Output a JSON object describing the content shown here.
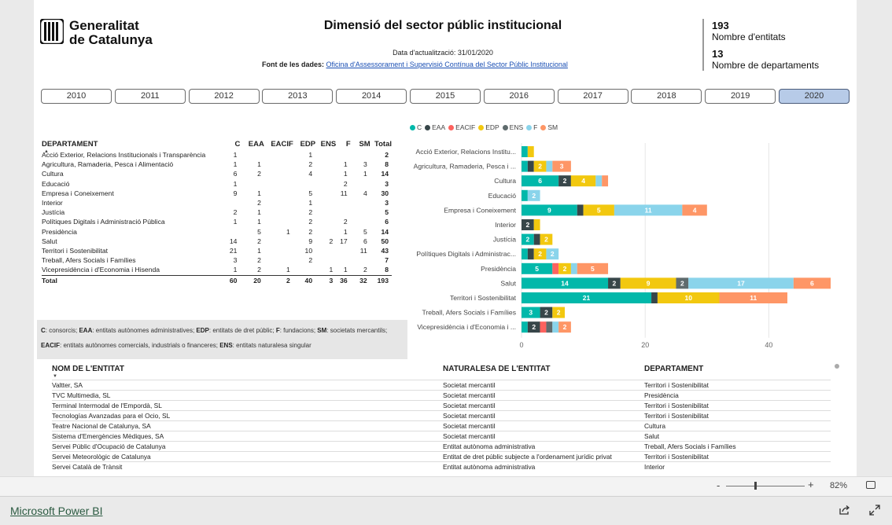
{
  "brand": {
    "line1": "Generalitat",
    "line2": "de Catalunya"
  },
  "report": {
    "title": "Dimensió del sector públic institucional",
    "update": "Data d'actualització: 31/01/2020",
    "source_label": "Font de les dades:",
    "source_link": "Oficina d'Assessorament i Supervisió Contínua del Sector Públic Institucional"
  },
  "kpis": {
    "entities_value": "193",
    "entities_label": "Nombre d'entitats",
    "departments_value": "13",
    "departments_label": "Nombre de departaments"
  },
  "years": [
    "2010",
    "2011",
    "2012",
    "2013",
    "2014",
    "2015",
    "2016",
    "2017",
    "2018",
    "2019",
    "2020"
  ],
  "selected_year": "2020",
  "dept_table": {
    "headers": [
      "DEPARTAMENT",
      "C",
      "EAA",
      "EACIF",
      "EDP",
      "ENS",
      "F",
      "SM",
      "Total"
    ],
    "rows": [
      [
        "Acció Exterior, Relacions Institucionals i Transparència",
        "1",
        "",
        "",
        "1",
        "",
        "",
        "",
        "2"
      ],
      [
        "Agricultura, Ramaderia, Pesca i Alimentació",
        "1",
        "1",
        "",
        "2",
        "",
        "1",
        "3",
        "8"
      ],
      [
        "Cultura",
        "6",
        "2",
        "",
        "4",
        "",
        "1",
        "1",
        "14"
      ],
      [
        "Educació",
        "1",
        "",
        "",
        "",
        "",
        "2",
        "",
        "3"
      ],
      [
        "Empresa i Coneixement",
        "9",
        "1",
        "",
        "5",
        "",
        "11",
        "4",
        "30"
      ],
      [
        "Interior",
        "",
        "2",
        "",
        "1",
        "",
        "",
        "",
        "3"
      ],
      [
        "Justícia",
        "2",
        "1",
        "",
        "2",
        "",
        "",
        "",
        "5"
      ],
      [
        "Polítiques Digitals i Administració Pública",
        "1",
        "1",
        "",
        "2",
        "",
        "2",
        "",
        "6"
      ],
      [
        "Presidència",
        "",
        "5",
        "1",
        "2",
        "",
        "1",
        "5",
        "14"
      ],
      [
        "Salut",
        "14",
        "2",
        "",
        "9",
        "2",
        "17",
        "6",
        "50"
      ],
      [
        "Territori i Sostenibilitat",
        "21",
        "1",
        "",
        "10",
        "",
        "",
        "11",
        "43"
      ],
      [
        "Treball, Afers Socials i Famílies",
        "3",
        "2",
        "",
        "2",
        "",
        "",
        "",
        "7"
      ],
      [
        "Vicepresidència i d'Economia i Hisenda",
        "1",
        "2",
        "1",
        "",
        "1",
        "1",
        "2",
        "8"
      ]
    ],
    "total": [
      "Total",
      "60",
      "20",
      "2",
      "40",
      "3",
      "36",
      "32",
      "193"
    ]
  },
  "legend_note": {
    "c": "C",
    "c_text": ": consorcis; ",
    "eaa": "EAA",
    "eaa_text": ": entitats autònomes administratives; ",
    "edp": "EDP",
    "edp_text": ": entitats de dret públic; ",
    "f": "F",
    "f_text": ": fundacions; ",
    "sm": "SM",
    "sm_text": ": societats mercantils;",
    "eacif": "EACIF",
    "eacif_text": ": entitats autònomes comercials, industrials o financeres; ",
    "ens": "ENS",
    "ens_text": ": entitats naturalesa singular"
  },
  "chart_data": {
    "type": "bar",
    "orientation": "horizontal",
    "stacked": true,
    "legend_position": "top-left",
    "categories": [
      "Acció Exterior, Relacions Institu...",
      "Agricultura, Ramaderia, Pesca i ...",
      "Cultura",
      "Educació",
      "Empresa i Coneixement",
      "Interior",
      "Justícia",
      "Polítiques Digitals i Administrac...",
      "Presidència",
      "Salut",
      "Territori i Sostenibilitat",
      "Treball, Afers Socials i Famílies",
      "Vicepresidència i d'Economia i ..."
    ],
    "series": [
      {
        "name": "C",
        "color": "#01B8AA",
        "values": [
          1,
          1,
          6,
          1,
          9,
          0,
          2,
          1,
          5,
          14,
          21,
          3,
          1
        ]
      },
      {
        "name": "EAA",
        "color": "#374649",
        "values": [
          0,
          1,
          2,
          0,
          1,
          2,
          1,
          1,
          0,
          2,
          1,
          2,
          2
        ]
      },
      {
        "name": "EACIF",
        "color": "#FD625E",
        "values": [
          0,
          0,
          0,
          0,
          0,
          0,
          0,
          0,
          1,
          0,
          0,
          0,
          1
        ]
      },
      {
        "name": "EDP",
        "color": "#F2C80F",
        "values": [
          1,
          2,
          4,
          0,
          5,
          1,
          2,
          2,
          2,
          9,
          10,
          2,
          0
        ]
      },
      {
        "name": "ENS",
        "color": "#5F6B6D",
        "values": [
          0,
          0,
          0,
          0,
          0,
          0,
          0,
          0,
          0,
          2,
          0,
          0,
          1
        ]
      },
      {
        "name": "F",
        "color": "#8AD4EB",
        "values": [
          0,
          1,
          1,
          2,
          11,
          0,
          0,
          2,
          1,
          17,
          0,
          0,
          1
        ]
      },
      {
        "name": "SM",
        "color": "#FE9666",
        "values": [
          0,
          3,
          1,
          0,
          4,
          0,
          0,
          0,
          5,
          6,
          11,
          0,
          2
        ]
      }
    ],
    "x_ticks": [
      "0",
      "20",
      "40"
    ],
    "xlim": [
      0,
      50
    ]
  },
  "entity_table": {
    "headers": [
      "NOM DE L'ENTITAT",
      "NATURALESA DE L'ENTITAT",
      "DEPARTAMENT"
    ],
    "rows": [
      [
        "Valtter, SA",
        "Societat mercantil",
        "Territori i Sostenibilitat"
      ],
      [
        "TVC Multimedia, SL",
        "Societat mercantil",
        "Presidència"
      ],
      [
        "Terminal Intermodal de l'Empordà, SL",
        "Societat mercantil",
        "Territori i Sostenibilitat"
      ],
      [
        "Tecnologías Avanzadas para el Ocio, SL",
        "Societat mercantil",
        "Territori i Sostenibilitat"
      ],
      [
        "Teatre Nacional de Catalunya, SA",
        "Societat mercantil",
        "Cultura"
      ],
      [
        "Sistema d'Emergències Mèdiques, SA",
        "Societat mercantil",
        "Salut"
      ],
      [
        "Servei Públic d'Ocupació de Catalunya",
        "Entitat autònoma administrativa",
        "Treball, Afers Socials i Famílies"
      ],
      [
        "Servei Meteorològic de Catalunya",
        "Entitat de dret públic subjecte a l'ordenament jurídic privat",
        "Territori i Sostenibilitat"
      ],
      [
        "Servei Català de Trànsit",
        "Entitat autònoma administrativa",
        "Interior"
      ]
    ]
  },
  "zoom": {
    "minus": "-",
    "plus": "+",
    "percent": "82%"
  },
  "footer": {
    "link": "Microsoft Power BI"
  },
  "icons": {
    "zoom_fit": "fit-to-page-icon",
    "share": "share-icon",
    "expand": "expand-icon"
  }
}
